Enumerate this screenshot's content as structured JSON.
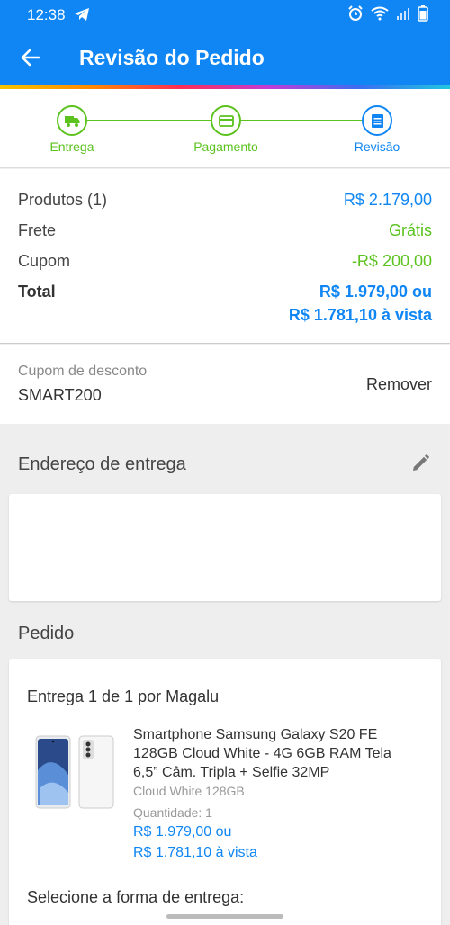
{
  "status_bar": {
    "time": "12:38"
  },
  "app_bar": {
    "title": "Revisão do Pedido"
  },
  "stepper": {
    "steps": [
      {
        "label": "Entrega",
        "icon": "truck-icon",
        "state": "done"
      },
      {
        "label": "Pagamento",
        "icon": "card-icon",
        "state": "done"
      },
      {
        "label": "Revisão",
        "icon": "list-icon",
        "state": "active"
      }
    ]
  },
  "totals": {
    "products_label": "Produtos (1)",
    "products_value": "R$ 2.179,00",
    "shipping_label": "Frete",
    "shipping_value": "Grátis",
    "coupon_label": "Cupom",
    "coupon_value": "-R$ 200,00",
    "total_label": "Total",
    "total_value_1": "R$ 1.979,00 ou",
    "total_value_2": "R$ 1.781,10 à vista"
  },
  "coupon": {
    "label": "Cupom de desconto",
    "code": "SMART200",
    "remove_label": "Remover"
  },
  "address": {
    "title": "Endereço de entrega"
  },
  "order": {
    "title": "Pedido",
    "delivery_title": "Entrega 1 de 1 por Magalu",
    "product_name": "Smartphone Samsung Galaxy S20 FE 128GB Cloud White - 4G 6GB RAM Tela 6,5” Câm. Tripla + Selfie 32MP",
    "variant": "Cloud White 128GB",
    "quantity": "Quantidade:  1",
    "price_1": "R$ 1.979,00 ou",
    "price_2": "R$ 1.781,10 à vista",
    "select_delivery": "Selecione a forma de entrega:"
  },
  "colors": {
    "primary": "#0f86f4",
    "success": "#5bc21e"
  }
}
